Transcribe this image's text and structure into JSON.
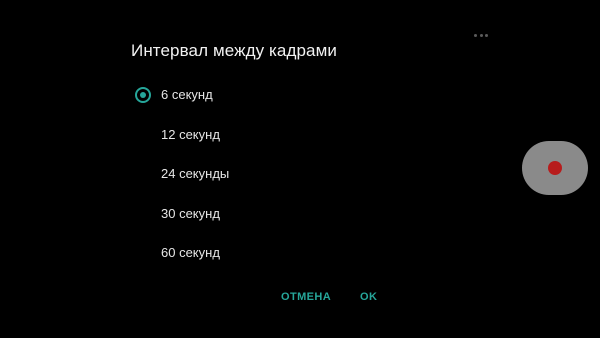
{
  "dialog": {
    "title": "Интервал между кадрами",
    "selected_index": 0,
    "options": [
      {
        "label": "6 секунд",
        "checked": true
      },
      {
        "label": "12 секунд",
        "checked": false
      },
      {
        "label": "24 секунды",
        "checked": false
      },
      {
        "label": "30 секунд",
        "checked": false
      },
      {
        "label": "60 секунд",
        "checked": false
      }
    ],
    "cancel_label": "ОТМЕНА",
    "ok_label": "OK"
  },
  "colors": {
    "accent": "#26a69a",
    "background": "#000000",
    "record_button": "#8a8a8a",
    "record_dot": "#b71c1c"
  },
  "icons": {
    "overflow": "more-dots-icon",
    "record": "record-icon",
    "radio_checked": "radio-checked-icon",
    "radio_unchecked": "radio-unchecked-icon"
  }
}
